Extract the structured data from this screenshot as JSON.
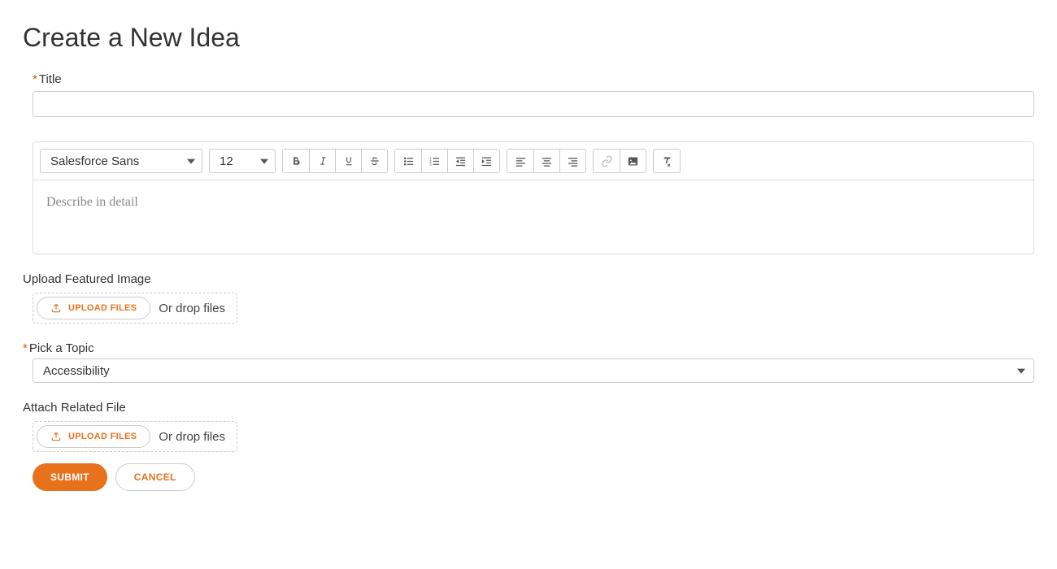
{
  "page": {
    "title": "Create a New Idea"
  },
  "form": {
    "title_label": "Title",
    "title_value": "",
    "description_placeholder": "Describe in detail",
    "upload_featured_label": "Upload Featured Image",
    "upload_button_label": "UPLOAD FILES",
    "drop_text": "Or drop files",
    "topic_label": "Pick a Topic",
    "topic_value": "Accessibility",
    "attach_label": "Attach Related File",
    "submit_label": "SUBMIT",
    "cancel_label": "CANCEL"
  },
  "rte": {
    "font_value": "Salesforce Sans",
    "size_value": "12"
  }
}
